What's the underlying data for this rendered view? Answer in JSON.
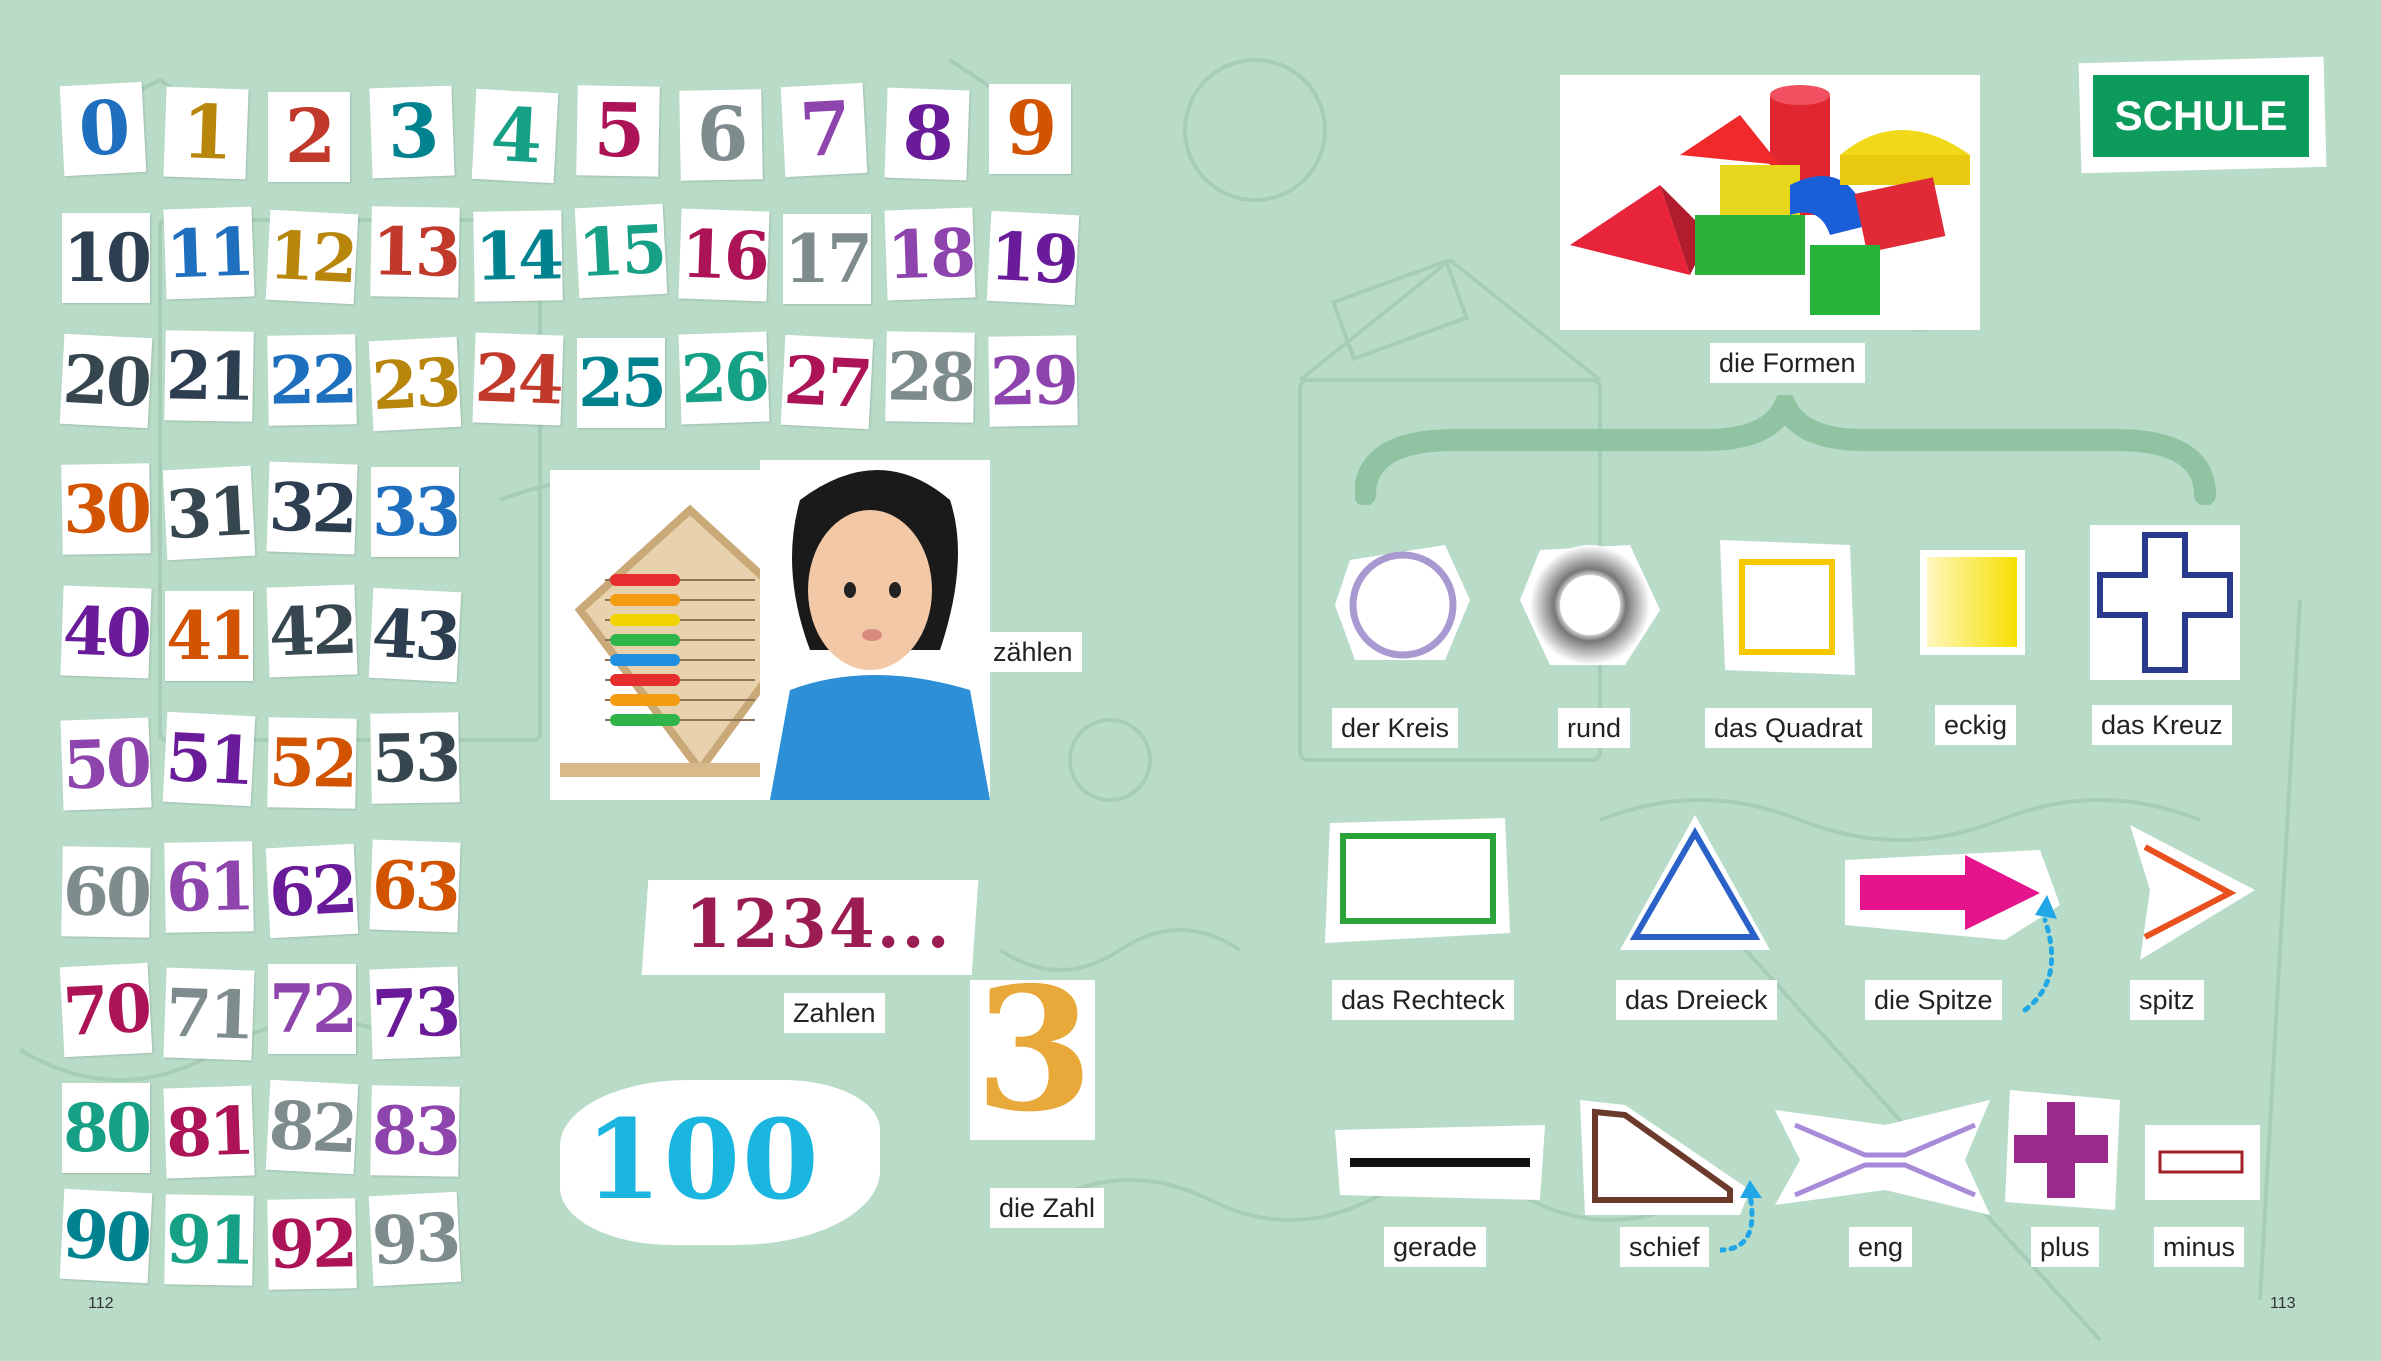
{
  "badge": {
    "label": "SCHULE"
  },
  "page_numbers": {
    "left": "112",
    "right": "113"
  },
  "numbers": [
    [
      "0",
      "1",
      "2",
      "3",
      "4",
      "5",
      "6",
      "7",
      "8",
      "9"
    ],
    [
      "10",
      "11",
      "12",
      "13",
      "14",
      "15",
      "16",
      "17",
      "18",
      "19"
    ],
    [
      "20",
      "21",
      "22",
      "23",
      "24",
      "25",
      "26",
      "27",
      "28",
      "29"
    ],
    [
      "30",
      "31",
      "32",
      "33"
    ],
    [
      "40",
      "41",
      "42",
      "43"
    ],
    [
      "50",
      "51",
      "52",
      "53"
    ],
    [
      "60",
      "61",
      "62",
      "63"
    ],
    [
      "70",
      "71",
      "72",
      "73"
    ],
    [
      "80",
      "81",
      "82",
      "83"
    ],
    [
      "90",
      "91",
      "92",
      "93"
    ]
  ],
  "left_labels": {
    "count": "zählen",
    "digits": "1234...",
    "numbers": "Zahlen",
    "three": "3",
    "number": "die Zahl",
    "hundred": "100"
  },
  "shapes_heading": "die Formen",
  "shape_rows": [
    [
      {
        "label": "der Kreis",
        "icon": "circle-icon",
        "color": "#a89ad0"
      },
      {
        "label": "rund",
        "icon": "round-icon",
        "color": "#444444"
      },
      {
        "label": "das Quadrat",
        "icon": "square-icon",
        "color": "#f6c800"
      },
      {
        "label": "eckig",
        "icon": "angular-icon",
        "color": "#f6e400"
      },
      {
        "label": "das Kreuz",
        "icon": "cross-icon",
        "color": "#2a3a8c"
      }
    ],
    [
      {
        "label": "das Rechteck",
        "icon": "rectangle-icon",
        "color": "#2aa33a"
      },
      {
        "label": "das Dreieck",
        "icon": "triangle-icon",
        "color": "#2a62c8"
      },
      {
        "label": "die Spitze",
        "icon": "arrow-tip-icon",
        "color": "#e6148c"
      },
      {
        "label": "spitz",
        "icon": "pointed-icon",
        "color": "#e8501e"
      }
    ],
    [
      {
        "label": "gerade",
        "icon": "straight-line-icon",
        "color": "#111111"
      },
      {
        "label": "schief",
        "icon": "slanted-icon",
        "color": "#6b3a2a"
      },
      {
        "label": "eng",
        "icon": "narrow-icon",
        "color": "#a88ad8"
      },
      {
        "label": "plus",
        "icon": "plus-icon",
        "color": "#9a2a8c"
      },
      {
        "label": "minus",
        "icon": "minus-icon",
        "color": "#a02028"
      }
    ]
  ]
}
